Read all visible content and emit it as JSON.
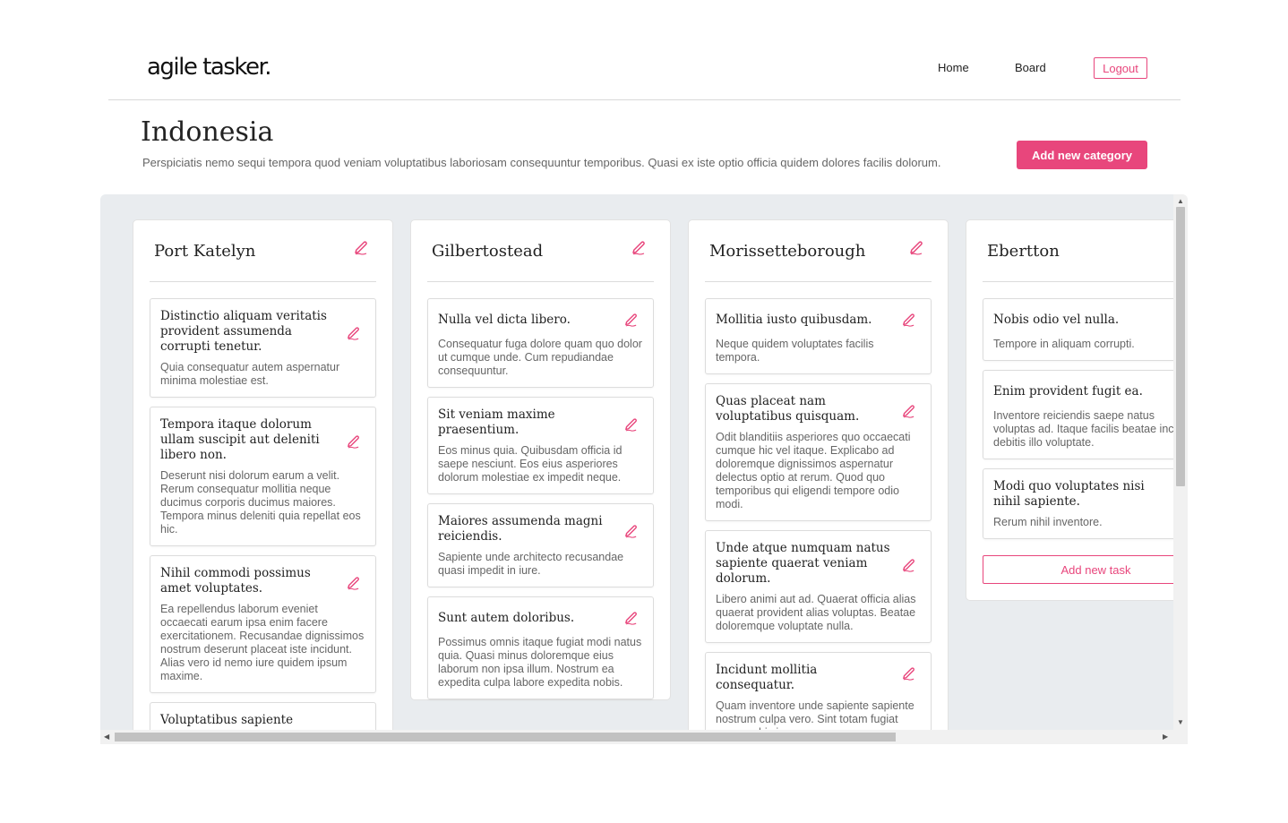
{
  "app": {
    "logo": "agile tasker.",
    "nav": {
      "home": "Home",
      "board": "Board",
      "logout": "Logout"
    }
  },
  "page": {
    "title": "Indonesia",
    "description": "Perspiciatis nemo sequi tempora quod veniam voluptatibus laboriosam consequuntur temporibus. Quasi ex iste optio officia quidem dolores facilis dolorum.",
    "add_category_label": "Add new category"
  },
  "accent_color": "#e8467c",
  "columns": [
    {
      "title": "Port Katelyn",
      "cards": [
        {
          "title": "Distinctio aliquam veritatis provident assumenda corrupti tenetur.",
          "desc": "Quia consequatur autem aspernatur minima molestiae est."
        },
        {
          "title": "Tempora itaque dolorum ullam suscipit aut deleniti libero non.",
          "desc": "Deserunt nisi dolorum earum a velit. Rerum consequatur mollitia neque ducimus corporis ducimus maiores. Tempora minus deleniti quia repellat eos hic."
        },
        {
          "title": "Nihil commodi possimus amet voluptates.",
          "desc": "Ea repellendus laborum eveniet occaecati earum ipsa enim facere exercitationem. Recusandae dignissimos nostrum deserunt placeat iste incidunt. Alias vero id nemo iure quidem ipsum maxime."
        },
        {
          "title": "Voluptatibus sapiente magnam",
          "desc": ""
        }
      ]
    },
    {
      "title": "Gilbertostead",
      "cards": [
        {
          "title": "Nulla vel dicta libero.",
          "desc": "Consequatur fuga dolore quam quo dolor ut cumque unde. Cum repudiandae consequuntur."
        },
        {
          "title": "Sit veniam maxime praesentium.",
          "desc": "Eos minus quia. Quibusdam officia id saepe nesciunt. Eos eius asperiores dolorum molestiae ex impedit neque."
        },
        {
          "title": "Maiores assumenda magni reiciendis.",
          "desc": "Sapiente unde architecto recusandae quasi impedit in iure."
        },
        {
          "title": "Sunt autem doloribus.",
          "desc": "Possimus omnis itaque fugiat modi natus quia. Quasi minus doloremque eius laborum non ipsa illum. Nostrum ea expedita culpa labore expedita nobis."
        }
      ]
    },
    {
      "title": "Morissetteborough",
      "cards": [
        {
          "title": "Mollitia iusto quibusdam.",
          "desc": "Neque quidem voluptates facilis tempora."
        },
        {
          "title": "Quas placeat nam voluptatibus quisquam.",
          "desc": "Odit blanditiis asperiores quo occaecati cumque hic vel itaque. Explicabo ad doloremque dignissimos aspernatur delectus optio at rerum. Quod quo temporibus qui eligendi tempore odio modi."
        },
        {
          "title": "Unde atque numquam natus sapiente quaerat veniam dolorum.",
          "desc": "Libero animi aut ad. Quaerat officia alias quaerat provident alias voluptas. Beatae doloremque voluptate nulla."
        },
        {
          "title": "Incidunt mollitia consequatur.",
          "desc": "Quam inventore unde sapiente sapiente nostrum culpa vero. Sint totam fugiat cumque hic ipsam"
        }
      ]
    },
    {
      "title": "Ebertton",
      "cards": [
        {
          "title": "Nobis odio vel nulla.",
          "desc": "Tempore in aliquam corrupti."
        },
        {
          "title": "Enim provident fugit ea.",
          "desc": "Inventore reiciendis saepe natus voluptas ad. Itaque facilis beatae incidunt debitis illo voluptate."
        },
        {
          "title": "Modi quo voluptates nisi nihil sapiente.",
          "desc": "Rerum nihil inventore."
        }
      ],
      "add_task_label": "Add new task"
    }
  ]
}
